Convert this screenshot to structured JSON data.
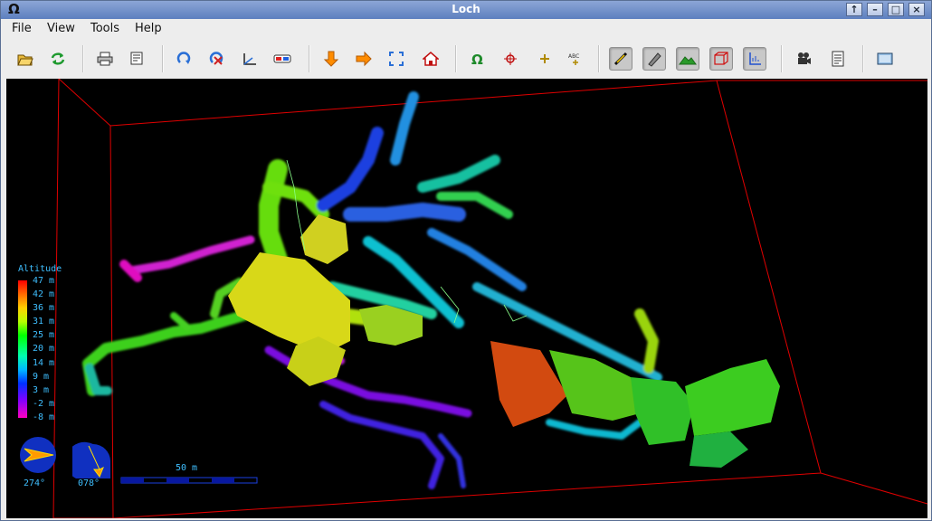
{
  "window": {
    "title": "Loch",
    "app_icon": "omega-icon",
    "buttons": [
      "up-arrow-icon",
      "minimize-icon",
      "maximize-icon",
      "close-icon"
    ]
  },
  "menu": {
    "items": [
      "File",
      "View",
      "Tools",
      "Help"
    ]
  },
  "toolbar": {
    "icons": [
      "open-icon",
      "reload-icon",
      "print-icon",
      "export-icon",
      "rotate-icon",
      "rotate-stop-icon",
      "tilt-icon",
      "stereo-icon",
      "plan-view-icon",
      "elevation-view-icon",
      "zoom-fit-icon",
      "home-icon",
      "entrances-icon",
      "fixed-points-icon",
      "stations-icon",
      "station-labels-icon",
      "centreline-icon",
      "walls-icon",
      "surface-icon",
      "bounding-box-icon",
      "axes-icon",
      "animate-icon",
      "log-icon",
      "fullscreen-icon"
    ]
  },
  "legend": {
    "title": "Altitude",
    "labels": [
      "47 m",
      "42 m",
      "36 m",
      "31 m",
      "25 m",
      "20 m",
      "14 m",
      "9 m",
      "3 m",
      "-2 m",
      "-8 m"
    ]
  },
  "compass": {
    "bearing": "274°",
    "tilt": "078°"
  },
  "scale_bar": {
    "label": "50 m"
  },
  "colors": {
    "box": "#e00000",
    "overlay_text": "#3fbfff"
  }
}
